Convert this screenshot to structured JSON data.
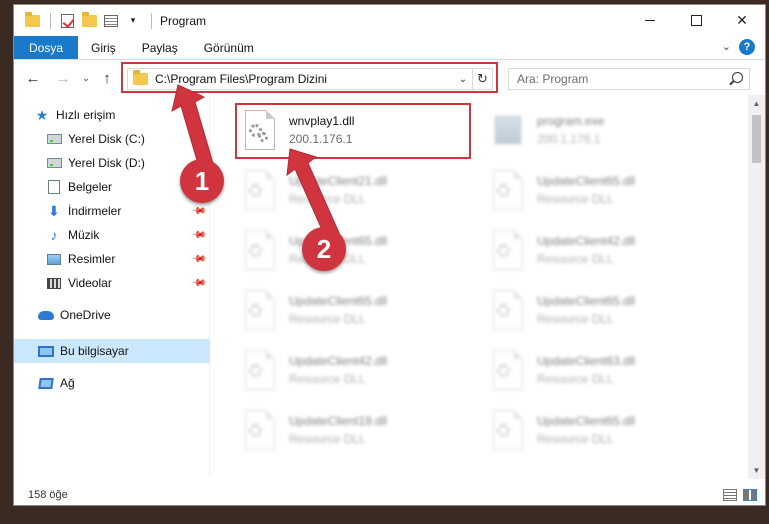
{
  "window": {
    "title": "Program",
    "caption": {
      "close": "✕"
    }
  },
  "ribbon": {
    "tabs": [
      "Dosya",
      "Giriş",
      "Paylaş",
      "Görünüm"
    ],
    "help": "?"
  },
  "navbar": {
    "address": "C:\\Program Files\\Program Dizini",
    "search_placeholder": "Ara: Program"
  },
  "sidebar": {
    "items": [
      {
        "label": "Hızlı erişim",
        "icon": "star-icon"
      },
      {
        "label": "Yerel Disk (C:)",
        "icon": "drive-icon"
      },
      {
        "label": "Yerel Disk (D:)",
        "icon": "drive-icon"
      },
      {
        "label": "Belgeler",
        "icon": "document-icon"
      },
      {
        "label": "İndirmeler",
        "icon": "download-icon"
      },
      {
        "label": "Müzik",
        "icon": "music-icon"
      },
      {
        "label": "Resimler",
        "icon": "pictures-icon"
      },
      {
        "label": "Videolar",
        "icon": "videos-icon"
      },
      {
        "label": "OneDrive",
        "icon": "cloud-icon"
      },
      {
        "label": "Bu bilgisayar",
        "icon": "computer-icon"
      },
      {
        "label": "Ağ",
        "icon": "network-icon"
      }
    ],
    "selected": "Bu bilgisayar"
  },
  "files": [
    {
      "name": "wnvplay1.dll",
      "sub": "200.1.176.1"
    },
    {
      "name": "program.exe",
      "sub": "200.1.176.1"
    },
    {
      "name": "UpdateClient21.dll",
      "sub": "Resource DLL"
    },
    {
      "name": "UpdateClient65.dll",
      "sub": "Resource DLL"
    },
    {
      "name": "UpdateClient65.dll",
      "sub": "Resource DLL"
    },
    {
      "name": "UpdateClient42.dll",
      "sub": "Resource DLL"
    },
    {
      "name": "UpdateClient65.dll",
      "sub": "Resource DLL"
    },
    {
      "name": "UpdateClient65.dll",
      "sub": "Resource DLL"
    },
    {
      "name": "UpdateClient42.dll",
      "sub": "Resource DLL"
    },
    {
      "name": "UpdateClient63.dll",
      "sub": "Resource DLL"
    },
    {
      "name": "UpdateClient19.dll",
      "sub": "Resource DLL"
    },
    {
      "name": "UpdateClient65.dll",
      "sub": "Resource DLL"
    }
  ],
  "status": {
    "count": "158 öğe"
  },
  "annotations": {
    "step1": "1",
    "step2": "2"
  },
  "colors": {
    "accent": "#1979ca",
    "highlight": "#d0343f",
    "selected_bg": "#cce8ff"
  }
}
